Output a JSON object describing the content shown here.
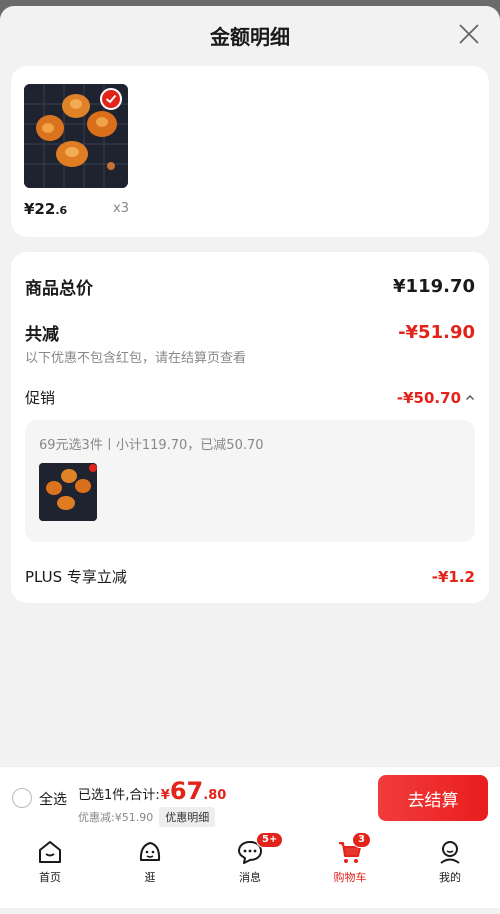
{
  "header": {
    "title": "金额明细"
  },
  "product": {
    "price_int": "¥22",
    "price_dec": ".6",
    "qty": "x3"
  },
  "summary": {
    "total_label": "商品总价",
    "total_value": "¥119.70",
    "reduce_label": "共减",
    "reduce_value": "-¥51.90",
    "note": "以下优惠不包含红包，请在结算页查看",
    "promo_label": "促销",
    "promo_value": "-¥50.70",
    "promo_detail": "69元选3件丨小计119.70，已减50.70",
    "plus_label": "PLUS 专享立减",
    "plus_value": "-¥1.2"
  },
  "bottom": {
    "select_all": "全选",
    "sum_label": "已选1件,合计:",
    "sum_yen": "¥",
    "sum_int": "67",
    "sum_dec": ".80",
    "discount_text": "优惠减:¥51.90",
    "detail_btn": "优惠明细",
    "checkout": "去结算"
  },
  "tabs": [
    {
      "label": "首页",
      "icon": "home-icon"
    },
    {
      "label": "逛",
      "icon": "browse-icon"
    },
    {
      "label": "消息",
      "icon": "message-icon",
      "badge": "5+"
    },
    {
      "label": "购物车",
      "icon": "cart-icon",
      "badge": "3",
      "active": true
    },
    {
      "label": "我的",
      "icon": "profile-icon"
    }
  ],
  "colors": {
    "accent": "#e2231a",
    "background": "#f2f2f2"
  }
}
